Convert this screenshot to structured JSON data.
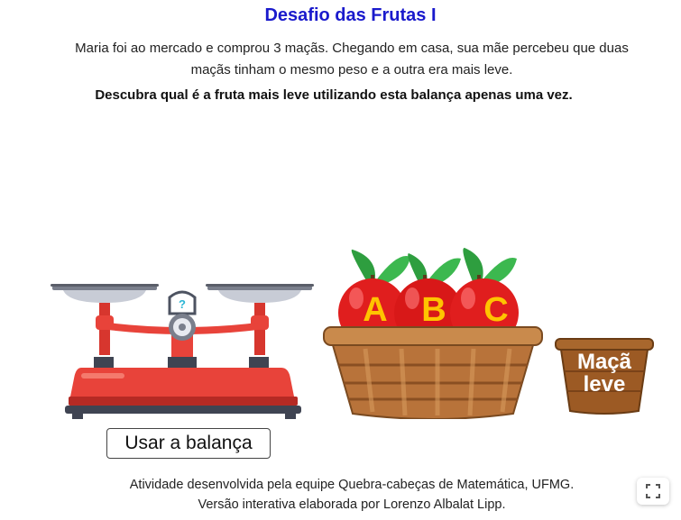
{
  "activity": {
    "title": "Desafio das Frutas I",
    "description_line1": "Maria foi ao mercado e comprou 3 maçãs. Chegando em casa, sua mãe percebeu que duas",
    "description_line2": "maçãs tinham o mesmo peso e a outra era mais leve.",
    "instruction": "Descubra qual é a fruta mais leve utilizando esta balança apenas uma vez."
  },
  "scale": {
    "dial_symbol": "?",
    "button_label": "Usar a balança"
  },
  "apples": [
    {
      "label": "A"
    },
    {
      "label": "B"
    },
    {
      "label": "C"
    }
  ],
  "light_apple_basket": {
    "line1": "Maçã",
    "line2": "leve"
  },
  "footer": {
    "line1": "Atividade desenvolvida pela equipe Quebra-cabeças de Matemática, UFMG.",
    "line2": "Versão interativa elaborada por Lorenzo Albalat Lipp."
  },
  "icons": {
    "fullscreen": "expand-icon"
  },
  "colors": {
    "title": "#1a1acc",
    "scale_red": "#e8433a",
    "apple_red": "#e01e1e",
    "apple_label": "#ffc400",
    "basket": "#b8733a",
    "leaf": "#2e9e3f"
  }
}
